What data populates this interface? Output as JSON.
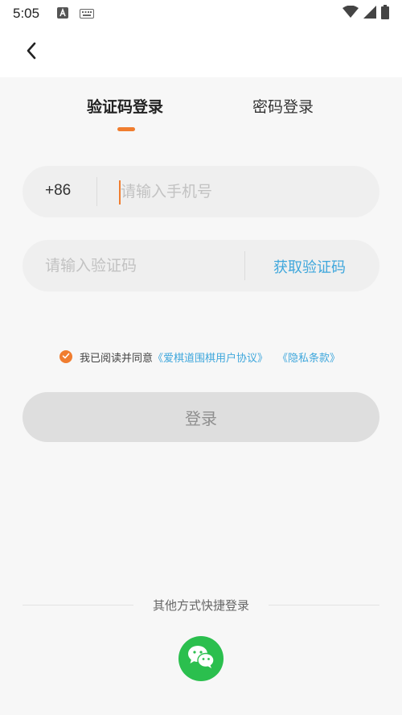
{
  "status_bar": {
    "time": "5:05",
    "icons": [
      "font-a-icon",
      "keyboard-icon",
      "wifi-icon",
      "signal-icon",
      "battery-icon"
    ]
  },
  "header": {
    "back_icon": "chevron-left-icon"
  },
  "tabs": [
    {
      "label": "验证码登录",
      "active": true
    },
    {
      "label": "密码登录",
      "active": false
    }
  ],
  "phone_field": {
    "country_code": "+86",
    "placeholder": "请输入手机号",
    "value": ""
  },
  "code_field": {
    "placeholder": "请输入验证码",
    "value": "",
    "get_code_label": "获取验证码"
  },
  "agreement": {
    "checked": true,
    "prefix": "我已阅读并同意",
    "link_user": "《爱棋道围棋用户协议》",
    "link_privacy": "《隐私条款》"
  },
  "login_button": {
    "label": "登录"
  },
  "other_login": {
    "label": "其他方式快捷登录",
    "options": [
      "wechat-icon"
    ]
  },
  "colors": {
    "accent": "#f07d2f",
    "link": "#3fa7dc",
    "wechat": "#2bbf4e",
    "field_bg": "#efefef",
    "button_disabled": "#dedede"
  }
}
